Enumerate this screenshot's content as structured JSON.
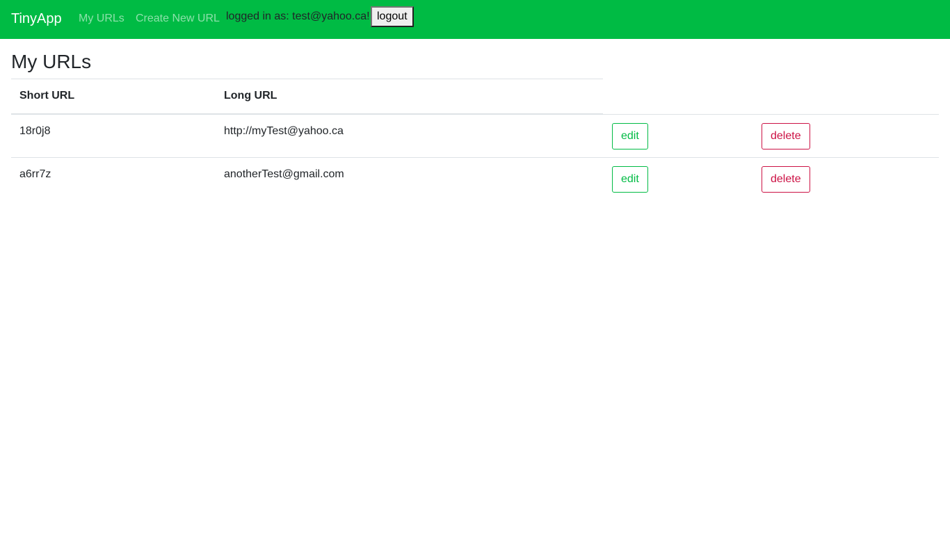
{
  "navbar": {
    "brand": "TinyApp",
    "links": [
      {
        "label": "My URLs"
      },
      {
        "label": "Create New URL"
      }
    ],
    "login_text": "logged in as: test@yahoo.ca!",
    "logout_label": "logout"
  },
  "main": {
    "title": "My URLs",
    "table": {
      "headers": {
        "short": "Short URL",
        "long": "Long URL"
      },
      "rows": [
        {
          "short": "18r0j8",
          "long": "http://myTest@yahoo.ca",
          "edit_label": "edit",
          "delete_label": "delete"
        },
        {
          "short": "a6rr7z",
          "long": "anotherTest@gmail.com",
          "edit_label": "edit",
          "delete_label": "delete"
        }
      ]
    }
  },
  "colors": {
    "navbar_bg": "#00bb44",
    "edit_accent": "#00bb44",
    "delete_accent": "#cc1144"
  }
}
